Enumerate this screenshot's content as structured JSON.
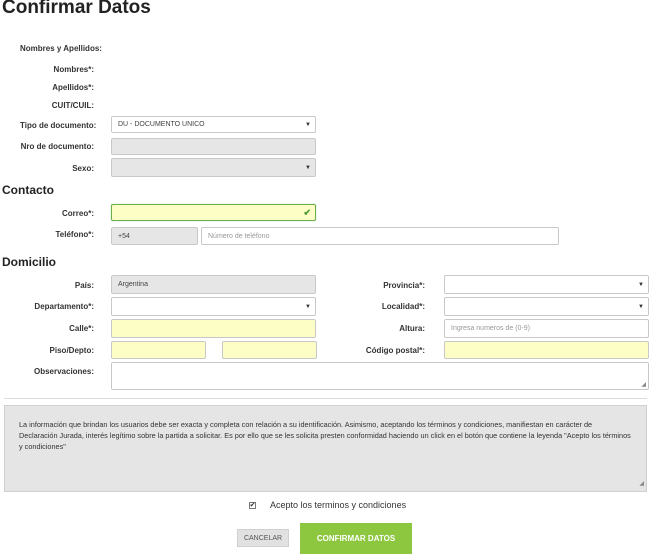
{
  "title": "Confirmar Datos",
  "personal": {
    "nombres_apellidos_label": "Nombres y Apellidos:",
    "nombres_label": "Nombres*:",
    "apellidos_label": "Apellidos*:",
    "cuit_label": "CUIT/CUIL:",
    "tipo_doc_label": "Tipo de documento:",
    "tipo_doc_value": "DU - DOCUMENTO UNICO",
    "nro_doc_label": "Nro de documento:",
    "nro_doc_value": "",
    "sexo_label": "Sexo:",
    "sexo_value": ""
  },
  "contacto": {
    "heading": "Contacto",
    "correo_label": "Correo*:",
    "correo_value": "",
    "telefono_label": "Teléfono*:",
    "telefono_prefix": "+54",
    "telefono_placeholder": "Número de teléfono"
  },
  "domicilio": {
    "heading": "Domicilio",
    "pais_label": "País:",
    "pais_value": "Argentina",
    "provincia_label": "Provincia*:",
    "provincia_value": "",
    "departamento_label": "Departamento*:",
    "departamento_value": "",
    "localidad_label": "Localidad*:",
    "localidad_value": "",
    "calle_label": "Calle*:",
    "calle_value": "",
    "altura_label": "Altura:",
    "altura_placeholder": "Ingresa numeros de (0-9)",
    "piso_label": "Piso/Depto:",
    "piso_value": "",
    "depto_value": "",
    "codigo_postal_label": "Código postal*:",
    "codigo_postal_value": "",
    "observaciones_label": "Observaciones:",
    "observaciones_value": ""
  },
  "info_text": "La información que brindan los usuarios debe ser exacta y completa con relación a su identificación. Asimismo, aceptando los términos y condiciones, manifiestan en carácter de Declaración Jurada, interés legítimo sobre la partida a solicitar. Es por ello que se les solicita presten conformidad haciendo un click en el botón que contiene la leyenda \"Acepto los términos y condiciones\"",
  "terms": {
    "checked_mark": "✔",
    "label": "Acepto los terminos y condiciones"
  },
  "buttons": {
    "cancel": "CANCELAR",
    "confirm": "CONFIRMAR DATOS"
  },
  "icons": {
    "select_caret": "▼",
    "valid_check": "✔",
    "resize": "◢"
  },
  "colors": {
    "confirm_button": "#8dc63f",
    "required_field": "#fdfdc6",
    "readonly_field": "#e6e6e6"
  }
}
